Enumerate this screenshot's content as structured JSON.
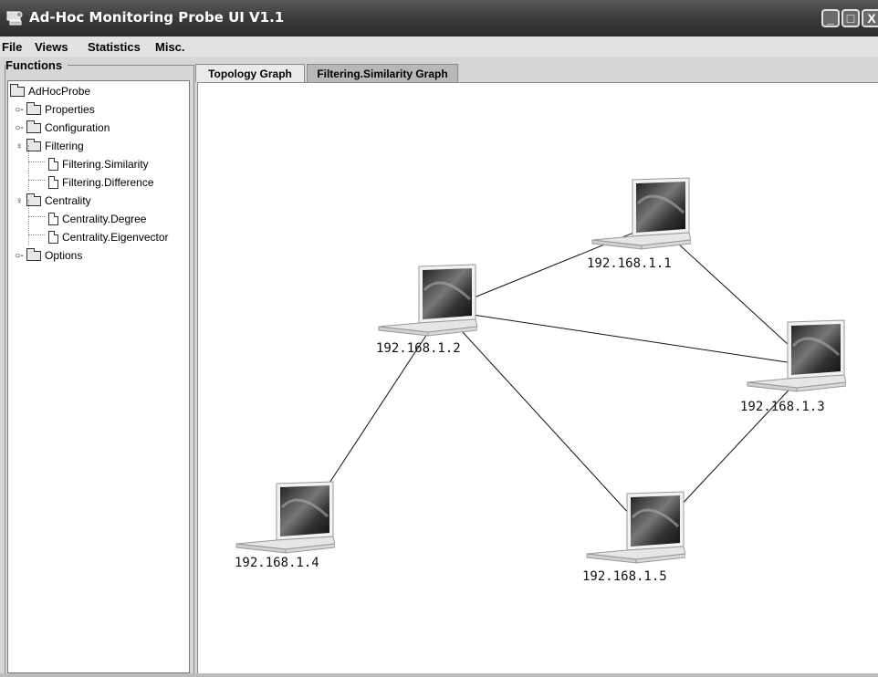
{
  "window": {
    "title": "Ad-Hoc Monitoring Probe UI V1.1",
    "controls": {
      "minimize": "_",
      "maximize": "□",
      "close": "X"
    }
  },
  "menubar": {
    "items": [
      "File",
      "Views",
      "Statistics",
      "Misc."
    ]
  },
  "functions": {
    "title": "Functions",
    "tree": [
      {
        "label": "AdHocProbe",
        "type": "folder",
        "level": 0,
        "expander": ""
      },
      {
        "label": "Properties",
        "type": "folder",
        "level": 1,
        "expander": "collapsed"
      },
      {
        "label": "Configuration",
        "type": "folder",
        "level": 1,
        "expander": "collapsed"
      },
      {
        "label": "Filtering",
        "type": "folder",
        "level": 1,
        "expander": "expanded"
      },
      {
        "label": "Filtering.Similarity",
        "type": "file",
        "level": 2,
        "expander": ""
      },
      {
        "label": "Filtering.Difference",
        "type": "file",
        "level": 2,
        "expander": ""
      },
      {
        "label": "Centrality",
        "type": "folder",
        "level": 1,
        "expander": "expanded"
      },
      {
        "label": "Centrality.Degree",
        "type": "file",
        "level": 2,
        "expander": ""
      },
      {
        "label": "Centrality.Eigenvector",
        "type": "file",
        "level": 2,
        "expander": ""
      },
      {
        "label": "Options",
        "type": "folder",
        "level": 1,
        "expander": "collapsed"
      }
    ]
  },
  "tabs": [
    {
      "label": "Topology Graph",
      "active": true
    },
    {
      "label": "Filtering.Similarity Graph",
      "active": false
    }
  ],
  "graph": {
    "nodes": [
      {
        "id": "n1",
        "label": "192.168.1.1",
        "icon": "laptop-icon"
      },
      {
        "id": "n2",
        "label": "192.168.1.2",
        "icon": "laptop-icon"
      },
      {
        "id": "n3",
        "label": "192.168.1.3",
        "icon": "laptop-icon"
      },
      {
        "id": "n4",
        "label": "192.168.1.4",
        "icon": "laptop-icon"
      },
      {
        "id": "n5",
        "label": "192.168.1.5",
        "icon": "laptop-icon"
      }
    ],
    "edges": [
      [
        "n2",
        "n1"
      ],
      [
        "n2",
        "n3"
      ],
      [
        "n1",
        "n3"
      ],
      [
        "n2",
        "n4"
      ],
      [
        "n2",
        "n5"
      ],
      [
        "n3",
        "n5"
      ]
    ]
  },
  "colors": {
    "titlebar": "#3a3a3a",
    "background": "#d6d6d6",
    "canvas": "#ffffff",
    "edge": "#111111"
  }
}
